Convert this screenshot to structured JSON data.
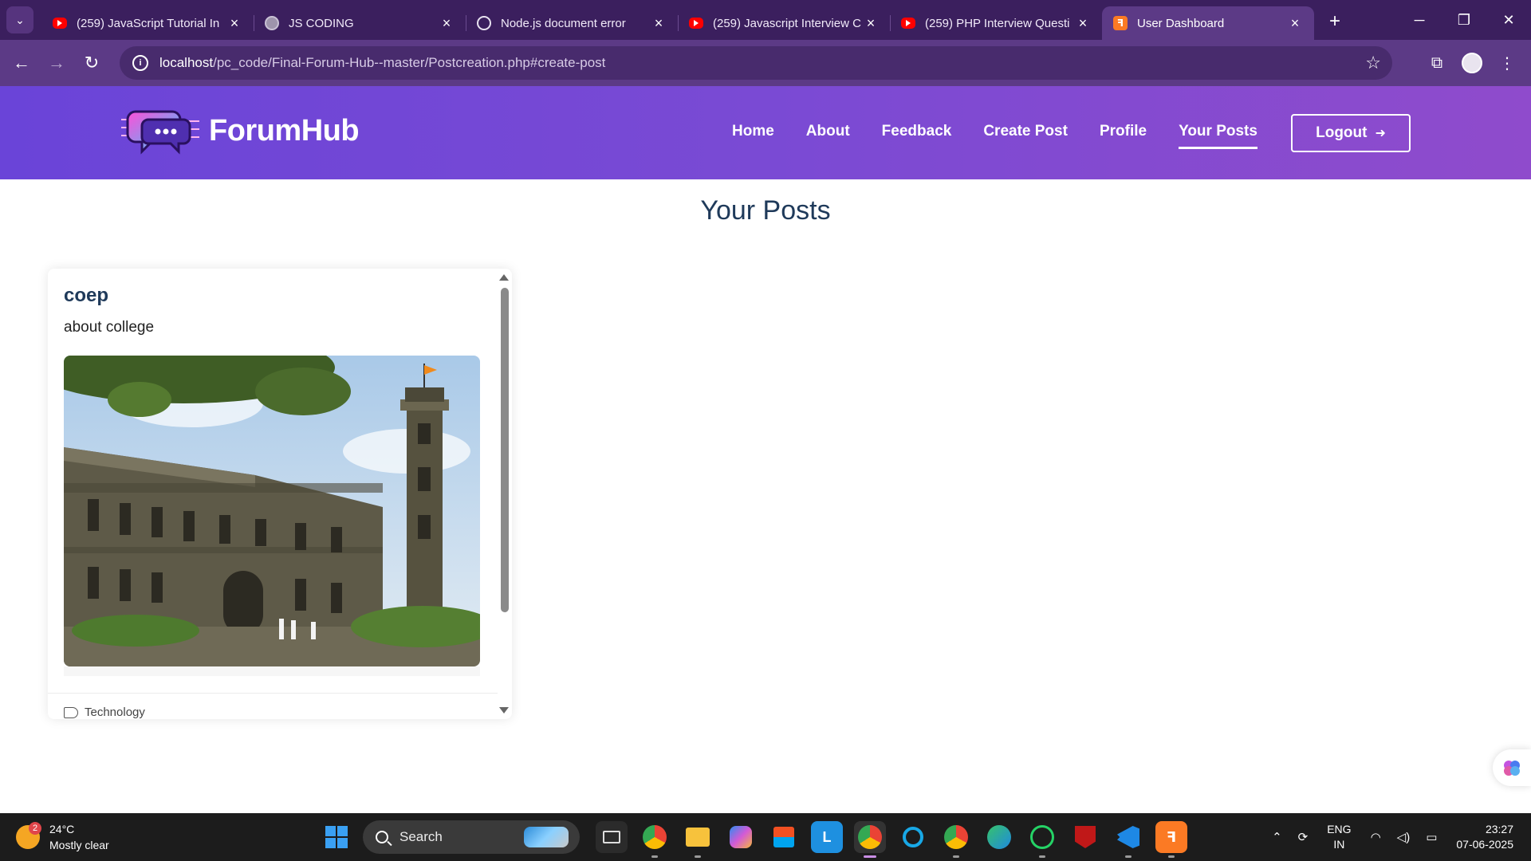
{
  "browser": {
    "tabs": [
      {
        "title": "(259) JavaScript Tutorial In",
        "favicon": "youtube-icon",
        "active": false
      },
      {
        "title": "JS CODING",
        "favicon": "globe-icon",
        "active": false
      },
      {
        "title": "Node.js document error",
        "favicon": "chatgpt-icon",
        "active": false
      },
      {
        "title": "(259) Javascript Interview C",
        "favicon": "youtube-icon",
        "active": false
      },
      {
        "title": "(259) PHP Interview Questi",
        "favicon": "youtube-icon",
        "active": false
      },
      {
        "title": "User Dashboard",
        "favicon": "xampp-icon",
        "active": true
      }
    ],
    "url_host": "localhost",
    "url_path": "/pc_code/Final-Forum-Hub--master/Postcreation.php#create-post"
  },
  "site": {
    "brand": "ForumHub",
    "nav": [
      {
        "label": "Home"
      },
      {
        "label": "About"
      },
      {
        "label": "Feedback"
      },
      {
        "label": "Create Post"
      },
      {
        "label": "Profile"
      },
      {
        "label": "Your Posts",
        "current": true
      }
    ],
    "logout_label": "Logout",
    "header_gradient": [
      "#6a44d8",
      "#8f4bcc"
    ]
  },
  "page": {
    "title": "Your Posts",
    "posts": [
      {
        "title": "coep",
        "description": "about college",
        "image": "college-building-photo",
        "tag": "Technology"
      }
    ]
  },
  "taskbar": {
    "weather_temp": "24°C",
    "weather_desc": "Mostly clear",
    "weather_badge": "2",
    "search_label": "Search",
    "lang_top": "ENG",
    "lang_bottom": "IN",
    "time": "23:27",
    "date": "07-06-2025"
  }
}
